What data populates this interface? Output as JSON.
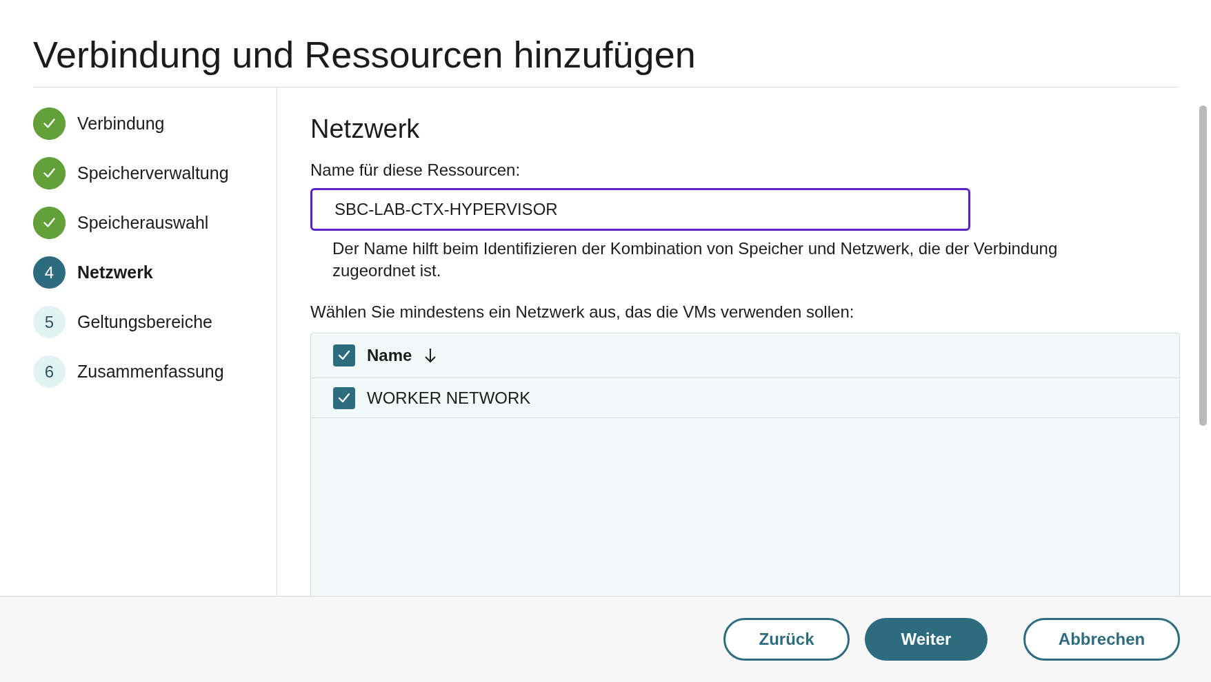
{
  "window": {
    "title": "Verbindung und Ressourcen hinzufügen"
  },
  "steps": [
    {
      "label": "Verbindung",
      "completed": true,
      "current": false
    },
    {
      "label": "Speicherverwaltung",
      "completed": true,
      "current": false
    },
    {
      "label": "Speicherauswahl",
      "completed": true,
      "current": false
    },
    {
      "marker": "4",
      "label": "Netzwerk",
      "completed": false,
      "current": true
    },
    {
      "marker": "5",
      "label": "Geltungsbereiche",
      "completed": false,
      "current": false
    },
    {
      "marker": "6",
      "label": "Zusammenfassung",
      "completed": false,
      "current": false
    }
  ],
  "section": {
    "heading": "Netzwerk"
  },
  "name_field": {
    "label": "Name für diese Ressourcen:",
    "value": "SBC-LAB-CTX-HYPERVISOR",
    "help": "Der Name hilft beim Identifizieren der Kombination von Speicher und Netzwerk, die der Verbindung zugeordnet ist."
  },
  "network_prompt": "Wählen Sie mindestens ein Netzwerk aus, das die VMs verwenden sollen:",
  "table": {
    "header_checked": true,
    "columns": [
      {
        "label": "Name",
        "sorted_descending": true
      }
    ],
    "rows": [
      {
        "name": "WORKER NETWORK",
        "checked": true
      }
    ]
  },
  "buttons": [
    {
      "label": "Zurück",
      "kind": "secondary"
    },
    {
      "label": "Weiter",
      "kind": "primary"
    },
    {
      "label": "Abbrechen",
      "kind": "secondary"
    }
  ]
}
